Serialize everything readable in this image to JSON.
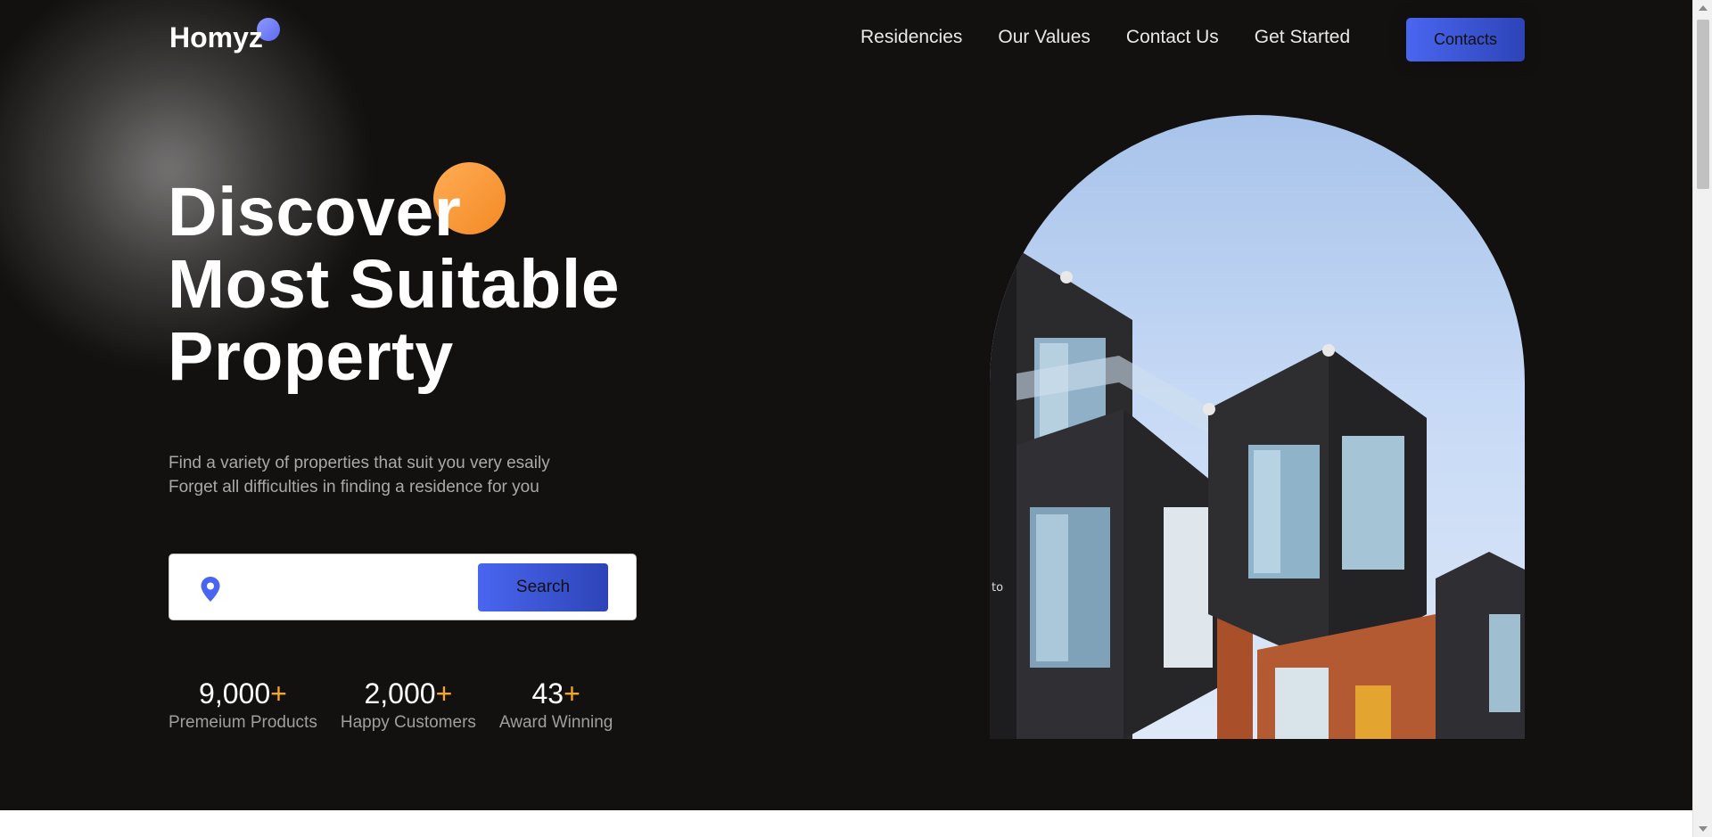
{
  "header": {
    "logo": "Homyz",
    "nav": [
      "Residencies",
      "Our Values",
      "Contact Us",
      "Get Started"
    ],
    "cta_label": "Contacts"
  },
  "hero": {
    "title_lines": [
      "Discover",
      "Most Suitable",
      "Property"
    ],
    "subtitle_lines": [
      "Find a variety of properties that suit you very esaily",
      "Forget all difficulties in finding a residence for you"
    ],
    "search": {
      "value": "",
      "button_label": "Search",
      "icon": "location-pin-icon"
    },
    "stats": [
      {
        "value": "9,000",
        "suffix": "+",
        "label": "Premeium Products"
      },
      {
        "value": "2,000",
        "suffix": "+",
        "label": "Happy Customers"
      },
      {
        "value": "43",
        "suffix": "+",
        "label": "Award Winning"
      }
    ],
    "image_overlay_text": "to"
  },
  "colors": {
    "background": "#131110",
    "accent_blue": "#4a66f0",
    "accent_orange": "#f5a623",
    "logo_dot": "#7d87f8"
  }
}
